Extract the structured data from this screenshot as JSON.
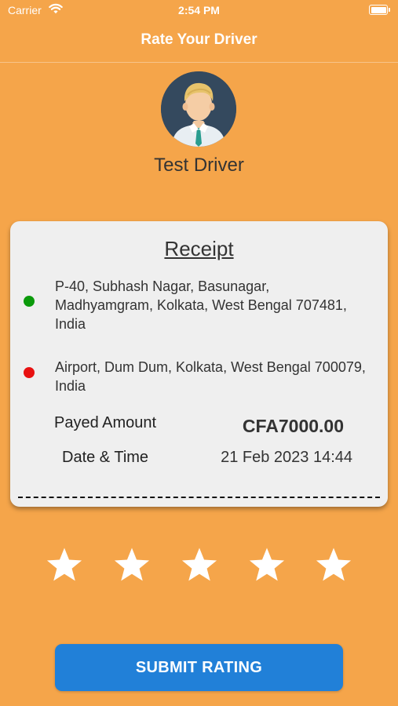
{
  "status_bar": {
    "carrier": "Carrier",
    "time": "2:54 PM"
  },
  "header": {
    "title": "Rate Your Driver"
  },
  "driver": {
    "name": "Test Driver",
    "avatar_icon": "driver-avatar-icon"
  },
  "receipt": {
    "title": "Receipt",
    "pickup": {
      "address": "P-40, Subhash Nagar, Basunagar, Madhyamgram, Kolkata, West Bengal 707481, India",
      "color": "#0B9A0B"
    },
    "drop": {
      "address": "Airport, Dum Dum, Kolkata, West Bengal 700079, India",
      "color": "#E81111"
    },
    "amount_label": "Payed Amount",
    "amount_value": "CFA7000.00",
    "datetime_label": "Date & Time",
    "datetime_value": "21 Feb 2023 14:44"
  },
  "rating": {
    "max_stars": 5,
    "selected": 0,
    "star_icon": "star-icon"
  },
  "submit": {
    "label": "SUBMIT RATING"
  },
  "colors": {
    "background": "#F5A54A",
    "card": "#EFEFEF",
    "button": "#2180D8"
  }
}
